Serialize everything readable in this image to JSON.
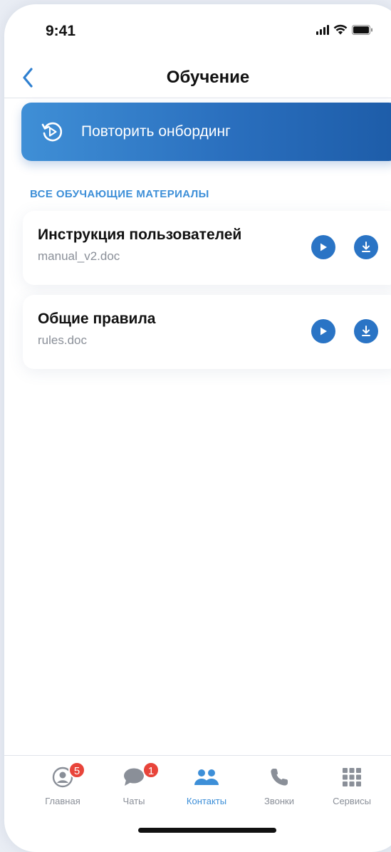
{
  "status_bar": {
    "time": "9:41"
  },
  "nav": {
    "title": "Обучение"
  },
  "onboarding": {
    "label": "Повторить онбординг"
  },
  "section": {
    "title": "ВСЕ ОБУЧАЮЩИЕ МАТЕРИАЛЫ"
  },
  "materials": [
    {
      "title": "Инструкция пользователей",
      "file": "manual_v2.doc"
    },
    {
      "title": "Общие правила",
      "file": "rules.doc"
    }
  ],
  "tabs": [
    {
      "label": "Главная",
      "badge": "5",
      "icon": "profile-icon"
    },
    {
      "label": "Чаты",
      "badge": "1",
      "icon": "chat-icon"
    },
    {
      "label": "Контакты",
      "badge": "",
      "icon": "contacts-icon",
      "active": true
    },
    {
      "label": "Звонки",
      "badge": "",
      "icon": "phone-icon"
    },
    {
      "label": "Сервисы",
      "badge": "",
      "icon": "grid-icon"
    }
  ],
  "colors": {
    "accent": "#3d8fd8",
    "button": "#2a74c5",
    "badge": "#e8443a",
    "muted": "#8a8f98"
  }
}
